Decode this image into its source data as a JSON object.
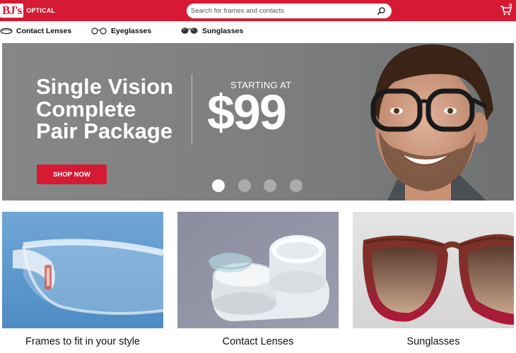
{
  "header": {
    "logo_mark": "BJ's",
    "logo_text": "OPTICAL",
    "search_placeholder": "Search for frames and contacts",
    "cart_count": "0"
  },
  "nav": {
    "items": [
      {
        "label": "Contact Lenses",
        "icon": "contact-lens-icon"
      },
      {
        "label": "Eyeglasses",
        "icon": "eyeglasses-icon"
      },
      {
        "label": "Sunglasses",
        "icon": "sunglasses-icon"
      }
    ]
  },
  "hero": {
    "title_lines": [
      "Single Vision",
      "Complete",
      "Pair Package"
    ],
    "starting_at": "STARTING AT",
    "price": "$99",
    "cta": "SHOP NOW",
    "slide_count": 4,
    "active_slide": 1
  },
  "cards": [
    {
      "label": "Frames to fit in your style"
    },
    {
      "label": "Contact Lenses"
    },
    {
      "label": "Sunglasses"
    }
  ],
  "colors": {
    "brand_red": "#d71a33",
    "hero_gray": "#7f8182"
  }
}
